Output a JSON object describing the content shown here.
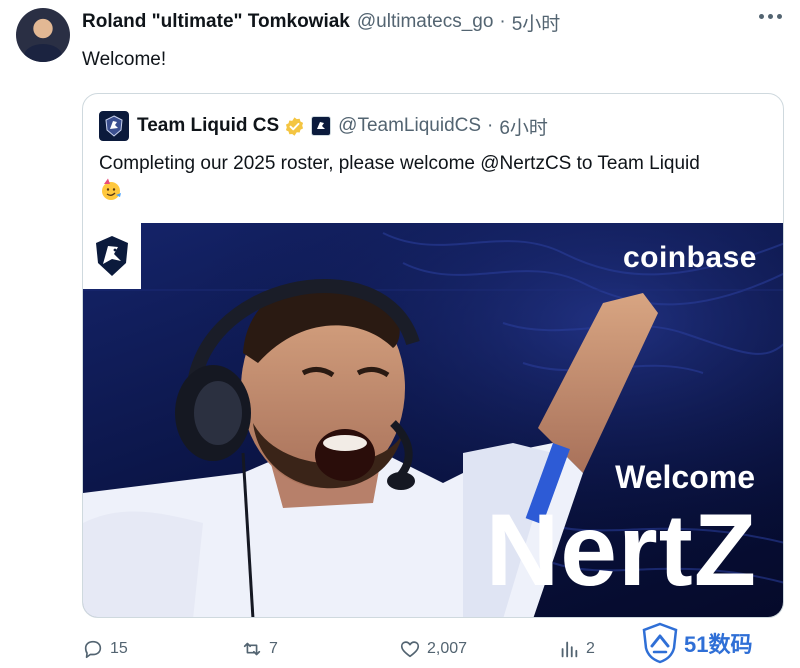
{
  "tweet": {
    "author_name": "Roland \"ultimate\" Tomkowiak",
    "author_handle": "@ultimatecs_go",
    "separator": "·",
    "time": "5小时",
    "text": "Welcome!"
  },
  "quote": {
    "author_name": "Team Liquid CS",
    "author_handle": "@TeamLiquidCS",
    "separator": "·",
    "time": "6小时",
    "text": "Completing our 2025 roster, please welcome @NertzCS to Team Liquid",
    "media": {
      "sponsor": "coinbase",
      "headline": "Welcome",
      "player": "NertZ"
    }
  },
  "actions": {
    "replies": "15",
    "reposts": "7",
    "likes": "2,007",
    "views": "2"
  },
  "watermark": {
    "text": "51数码"
  },
  "colors": {
    "text_primary": "#0f1419",
    "text_secondary": "#536471",
    "verified_gold": "#f4c542",
    "media_navy": "#0b1547"
  }
}
